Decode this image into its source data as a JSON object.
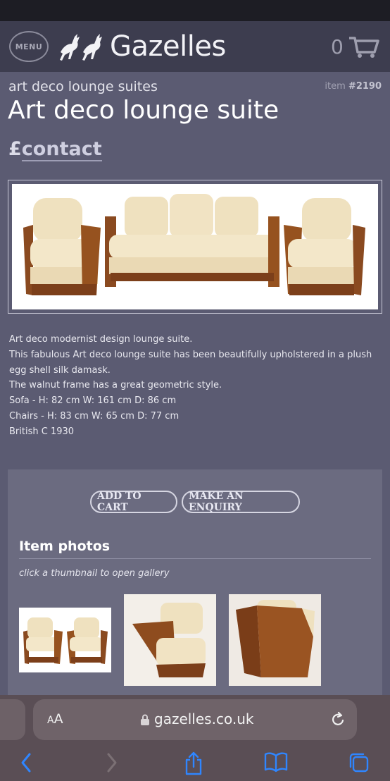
{
  "header": {
    "menu_label": "MENU",
    "logo_text": "Gazelles",
    "cart_count": "0"
  },
  "product": {
    "category": "art deco lounge suites",
    "item_label": "item",
    "item_number": "#2190",
    "title": "Art deco lounge suite",
    "currency": "£",
    "price_link": "contact"
  },
  "description": [
    "Art deco modernist design lounge suite.",
    "This fabulous Art deco lounge suite has been beautifully upholstered in a plush",
    "egg shell silk damask.",
    "The walnut frame has a great geometric style.",
    "Sofa - H: 82 cm W: 161 cm D: 86 cm",
    "Chairs - H: 83 cm W: 65 cm D: 77 cm",
    "British C 1930"
  ],
  "actions": {
    "add_to_cart": "ADD TO CART",
    "make_enquiry": "MAKE AN ENQUIRY"
  },
  "photos": {
    "heading": "Item photos",
    "hint": "click a thumbnail to open gallery"
  },
  "browser": {
    "aa_large": "A",
    "aa_small": "A",
    "url": "gazelles.co.uk"
  },
  "colors": {
    "page_bg": "#5b5b72",
    "header_bg": "#3d3d4f",
    "panel_bg": "#6b6b80",
    "walnut": "#8a4a20",
    "upholstery": "#efe1bf"
  },
  "icons": [
    "gazelle-logo-icon",
    "cart-icon",
    "lock-icon",
    "reload-icon",
    "back-icon",
    "forward-icon",
    "share-icon",
    "bookmarks-icon",
    "tabs-icon"
  ]
}
